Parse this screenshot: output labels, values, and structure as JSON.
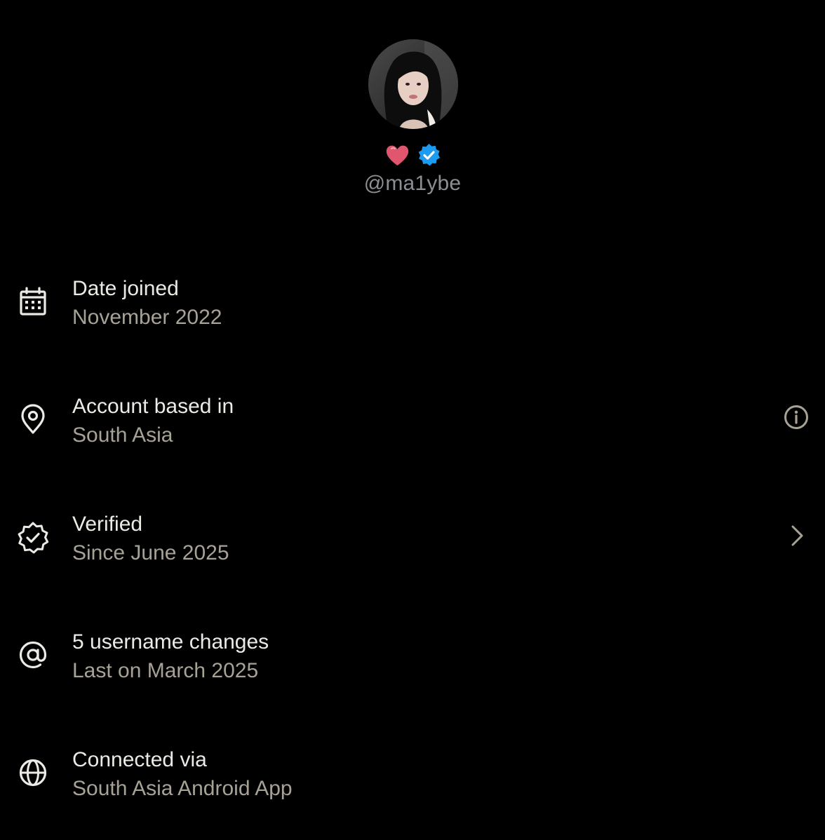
{
  "profile": {
    "handle": "@ma1ybe",
    "avatar_icon": "profile-photo",
    "badges": [
      "heart-icon",
      "verified-badge-icon"
    ]
  },
  "rows": [
    {
      "icon": "calendar-icon",
      "label": "Date joined",
      "value": "November 2022"
    },
    {
      "icon": "location-pin-icon",
      "label": "Account based in",
      "value": "South Asia",
      "action_icon": "info-icon"
    },
    {
      "icon": "verified-check-icon",
      "label": "Verified",
      "value": "Since June 2025",
      "action_icon": "chevron-right-icon"
    },
    {
      "icon": "at-sign-icon",
      "label": "5 username changes",
      "value": "Last on March 2025"
    },
    {
      "icon": "globe-icon",
      "label": "Connected via",
      "value": "South Asia Android App"
    }
  ],
  "colors": {
    "background": "#000000",
    "label_text": "#eceae4",
    "value_text": "#a8a296",
    "handle_text": "#8b8f94",
    "heart": "#e0566f",
    "verified": "#1d9bf0"
  }
}
